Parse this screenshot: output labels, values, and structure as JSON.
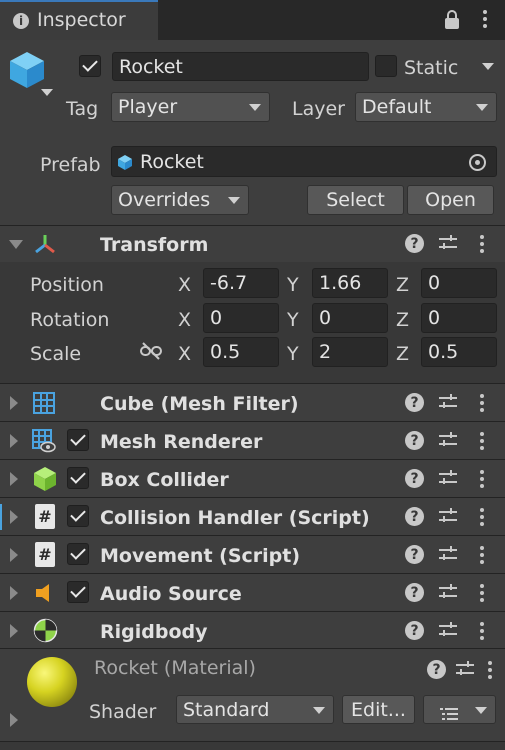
{
  "tab": {
    "title": "Inspector",
    "lock_icon": "lock-icon",
    "menu_icon": "kebab-icon"
  },
  "header": {
    "object_name": "Rocket",
    "active": true,
    "static_label": "Static",
    "static": false,
    "tag_label": "Tag",
    "tag_value": "Player",
    "layer_label": "Layer",
    "layer_value": "Default"
  },
  "prefab": {
    "label": "Prefab",
    "value": "Rocket",
    "overrides_label": "Overrides",
    "select_label": "Select",
    "open_label": "Open"
  },
  "transform": {
    "title": "Transform",
    "position_label": "Position",
    "rotation_label": "Rotation",
    "scale_label": "Scale",
    "position": {
      "x": "-6.7",
      "y": "1.66",
      "z": "0"
    },
    "rotation": {
      "x": "0",
      "y": "0",
      "z": "0"
    },
    "scale": {
      "x": "0.5",
      "y": "2",
      "z": "0.5"
    },
    "axis_x": "X",
    "axis_y": "Y",
    "axis_z": "Z"
  },
  "components": [
    {
      "name": "Cube (Mesh Filter)",
      "icon": "mesh-filter-icon",
      "has_checkbox": false
    },
    {
      "name": "Mesh Renderer",
      "icon": "mesh-renderer-icon",
      "has_checkbox": true
    },
    {
      "name": "Box Collider",
      "icon": "box-collider-icon",
      "has_checkbox": true
    },
    {
      "name": "Collision Handler (Script)",
      "icon": "script-icon",
      "has_checkbox": true
    },
    {
      "name": "Movement (Script)",
      "icon": "script-icon",
      "has_checkbox": true
    },
    {
      "name": "Audio Source",
      "icon": "audio-source-icon",
      "has_checkbox": true
    },
    {
      "name": "Rigidbody",
      "icon": "rigidbody-icon",
      "has_checkbox": false
    }
  ],
  "material": {
    "name": "Rocket (Material)",
    "shader_label": "Shader",
    "shader_value": "Standard",
    "edit_label": "Edit...",
    "sphere_color": "#d6d321"
  },
  "colors": {
    "background": "#383838",
    "header_bg": "#3e3e3e",
    "tab_bg": "#3c3c3c",
    "field_bg": "#2a2a2a",
    "accent_blue": "#4aa3e0",
    "collider_green": "#8fd34a",
    "audio_orange": "#f0a020"
  }
}
